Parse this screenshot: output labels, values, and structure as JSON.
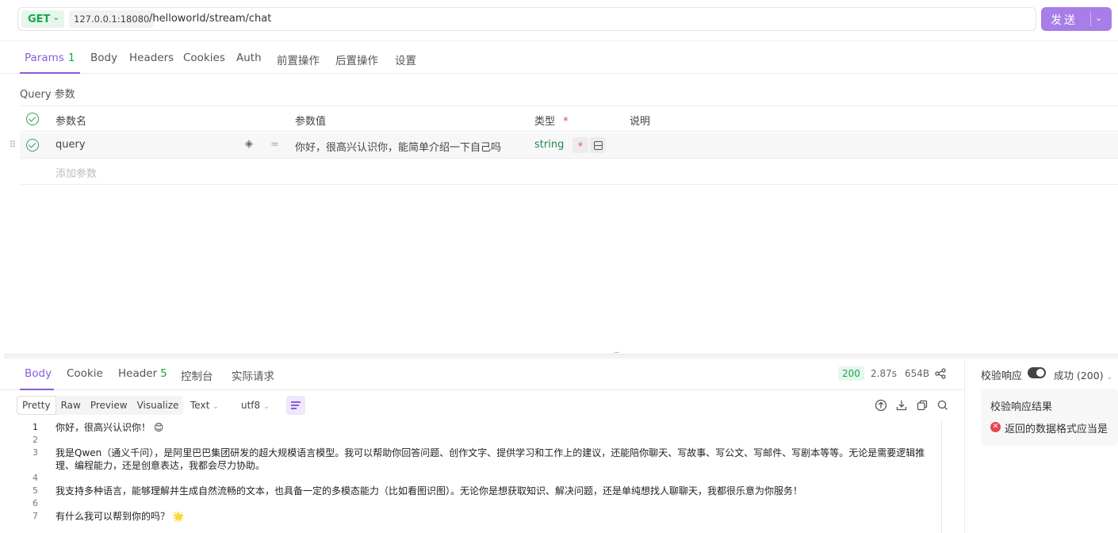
{
  "request": {
    "method": "GET",
    "host": "127.0.0.1:18080",
    "path": "/helloworld/stream/chat",
    "send_label": "发送"
  },
  "request_tabs": [
    {
      "label": "Params",
      "count": "1"
    },
    {
      "label": "Body"
    },
    {
      "label": "Headers"
    },
    {
      "label": "Cookies"
    },
    {
      "label": "Auth"
    },
    {
      "label": "前置操作"
    },
    {
      "label": "后置操作"
    },
    {
      "label": "设置"
    }
  ],
  "params": {
    "section_title": "Query 参数",
    "headers": {
      "name": "参数名",
      "value": "参数值",
      "type": "类型",
      "required_mark": "*",
      "desc": "说明"
    },
    "rows": [
      {
        "name": "query",
        "value": "你好，很高兴认识你，能简单介绍一下自己吗",
        "type": "string",
        "required_mark": "*"
      }
    ],
    "add_placeholder": "添加参数"
  },
  "response": {
    "tabs": [
      {
        "label": "Body"
      },
      {
        "label": "Cookie"
      },
      {
        "label": "Header",
        "count": "5"
      },
      {
        "label": "控制台"
      },
      {
        "label": "实际请求"
      }
    ],
    "status_code": "200",
    "time": "2.87s",
    "size": "654B",
    "view_modes": [
      "Pretty",
      "Raw",
      "Preview",
      "Visualize"
    ],
    "format": "Text",
    "encoding": "utf8",
    "lines": [
      {
        "n": "1",
        "text": "你好，很高兴认识你！ 😊"
      },
      {
        "n": "2",
        "text": ""
      },
      {
        "n": "3",
        "text": "我是Qwen（通义千问），是阿里巴巴集团研发的超大规模语言模型。我可以帮助你回答问题、创作文字、提供学习和工作上的建议，还能陪你聊天、写故事、写公文、写邮件、写剧本等等。无论是需要逻辑推理、编程能力，还是创意表达，我都会尽力协助。"
      },
      {
        "n": "4",
        "text": ""
      },
      {
        "n": "5",
        "text": "我支持多种语言，能够理解并生成自然流畅的文本，也具备一定的多模态能力（比如看图识图）。无论你是想获取知识、解决问题，还是单纯想找人聊聊天，我都很乐意为你服务！"
      },
      {
        "n": "6",
        "text": ""
      },
      {
        "n": "7",
        "text": "有什么我可以帮到你的吗？ 🌟"
      }
    ]
  },
  "validation": {
    "label": "校验响应",
    "enabled": true,
    "status": "成功 (200)",
    "result_title": "校验响应结果",
    "result_message": "返回的数据格式应当是"
  },
  "colors": {
    "accent": "#8a5cd8",
    "send_button": "#a87de8",
    "success": "#1aa64a",
    "error": "#e5484d"
  }
}
